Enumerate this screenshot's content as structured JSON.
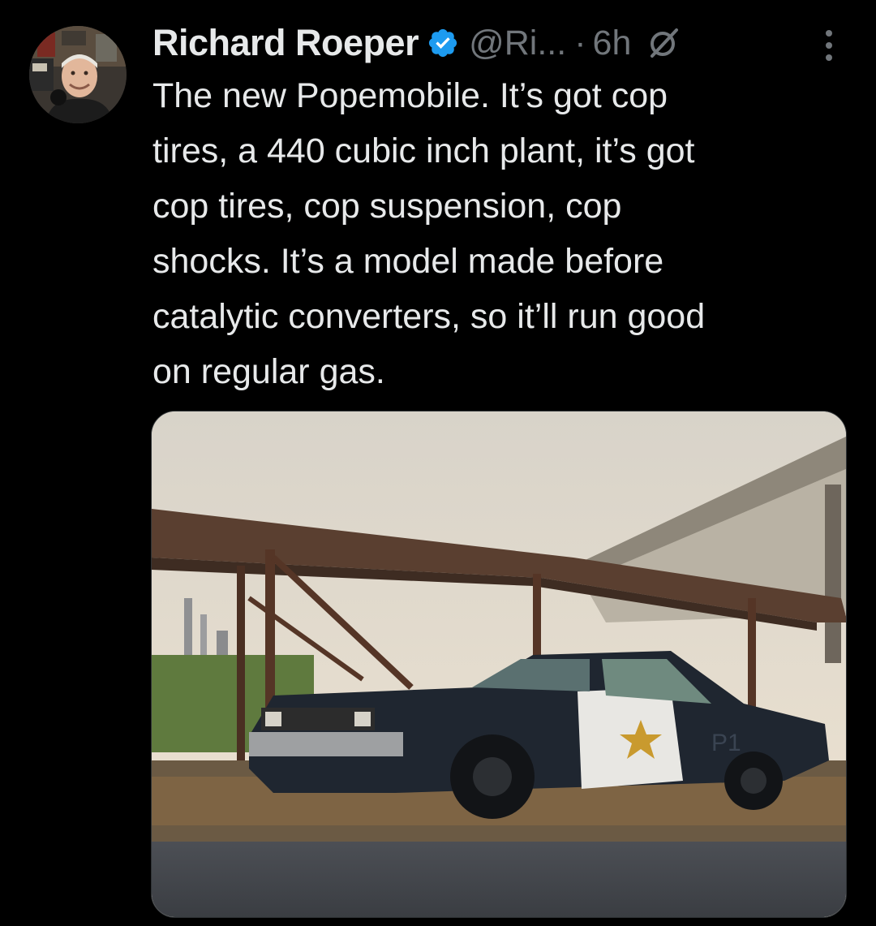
{
  "tweet": {
    "author": {
      "display_name": "Richard Roeper",
      "handle": "@Ri...",
      "verified": true,
      "avatar_icon": "profile-photo"
    },
    "separator": "·",
    "time": "6h",
    "grok_icon": "grok-icon",
    "more_icon": "more-vertical-icon",
    "text": "The new Popemobile. It’s got cop\ntires, a 440 cubic inch plant, it’s got\ncop tires, cop suspension, cop\nshocks. It’s a model made before\ncatalytic converters, so it’ll run good\non regular gas.",
    "media": {
      "type": "photo",
      "subject": "police-style sedan parked under rusted metal canopy",
      "car_door_text": "P1"
    }
  },
  "colors": {
    "background": "#000000",
    "text_primary": "#e7e9ea",
    "text_secondary": "#71767b",
    "verified_blue": "#1d9bf0"
  }
}
